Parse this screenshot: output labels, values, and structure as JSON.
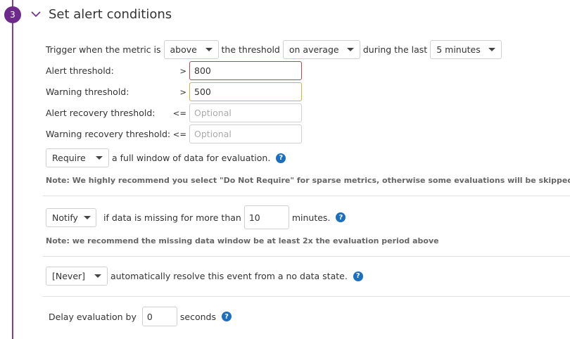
{
  "step": {
    "number": "3",
    "title": "Set alert conditions"
  },
  "trigger": {
    "prefix": "Trigger when the metric is",
    "comparator": "above",
    "mid1": "the threshold",
    "aggregation": "on average",
    "mid2": "during the last",
    "window": "5 minutes"
  },
  "thresholds": [
    {
      "label": "Alert threshold:",
      "op": ">",
      "value": "800",
      "placeholder": ""
    },
    {
      "label": "Warning threshold:",
      "op": ">",
      "value": "500",
      "placeholder": ""
    },
    {
      "label": "Alert recovery threshold:",
      "op": "<=",
      "value": "",
      "placeholder": "Optional"
    },
    {
      "label": "Warning recovery threshold:",
      "op": "<=",
      "value": "",
      "placeholder": "Optional"
    }
  ],
  "require": {
    "select": "Require",
    "text": "a full window of data for evaluation.",
    "note": "Note: We highly recommend you select \"Do Not Require\" for sparse metrics, otherwise some evaluations will be skipped."
  },
  "notify": {
    "select": "Notify",
    "text1": "if data is missing for more than",
    "minutes_value": "10",
    "text2": "minutes.",
    "note": "Note: we recommend the missing data window be at least 2x the evaluation period above"
  },
  "resolve": {
    "select": "[Never]",
    "text": "automatically resolve this event from a no data state."
  },
  "delay": {
    "label": "Delay evaluation by",
    "value": "0",
    "unit": "seconds"
  },
  "help_glyph": "?",
  "colors": {
    "accent": "#6d2a8c",
    "alert_border": "#d33b49",
    "warning_border": "#e4a93a",
    "help": "#1c6ebe"
  }
}
